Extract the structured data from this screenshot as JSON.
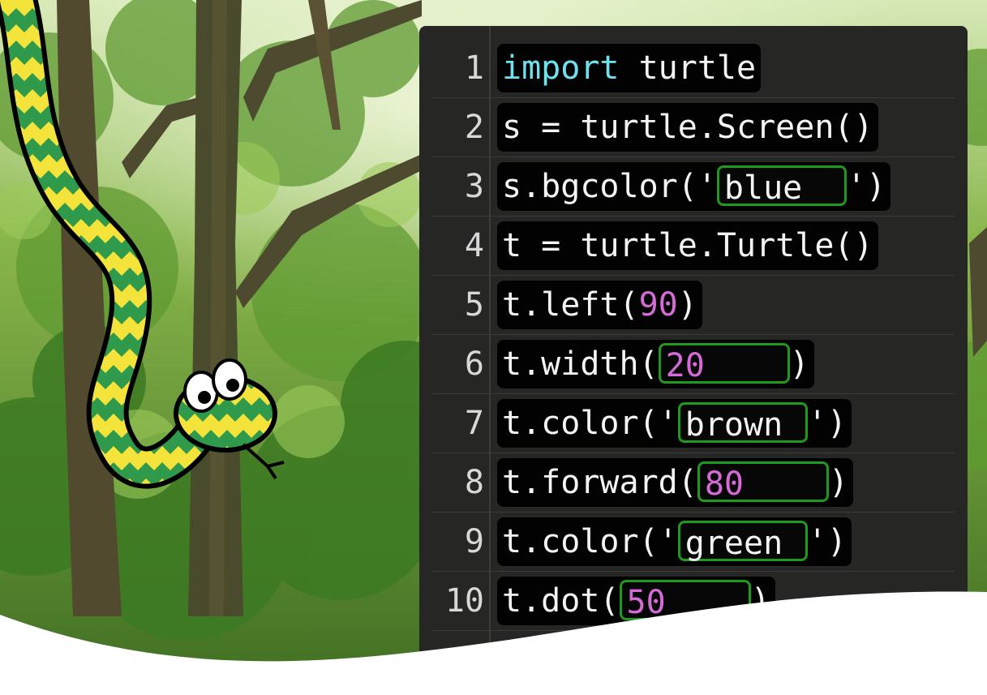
{
  "background": "forest-photo",
  "mascot": "python-snake-illustration",
  "colors": {
    "keyword": "#6fe2ef",
    "number": "#d66bd8",
    "slot_border": "#1f9a1f",
    "editor_bg": "#262624"
  },
  "code": {
    "lines": [
      {
        "num": "1",
        "kw": "import",
        "rest": " turtle"
      },
      {
        "num": "2",
        "text": "s = turtle.Screen()"
      },
      {
        "num": "3",
        "pre": "s.bgcolor('",
        "slot": "blue",
        "post": "')"
      },
      {
        "num": "4",
        "text": "t = turtle.Turtle()"
      },
      {
        "num": "5",
        "pre": "t.left(",
        "n": "90",
        "post": ")"
      },
      {
        "num": "6",
        "pre": "t.width(",
        "slot": "20",
        "post": ")"
      },
      {
        "num": "7",
        "pre": "t.color('",
        "slot": "brown",
        "post": "')"
      },
      {
        "num": "8",
        "pre": "t.forward(",
        "slot": "80",
        "post": ")"
      },
      {
        "num": "9",
        "pre": "t.color('",
        "slot": "green",
        "post": "')"
      },
      {
        "num": "10",
        "pre": "t.dot(",
        "slot": "50",
        "post": ")"
      }
    ]
  }
}
